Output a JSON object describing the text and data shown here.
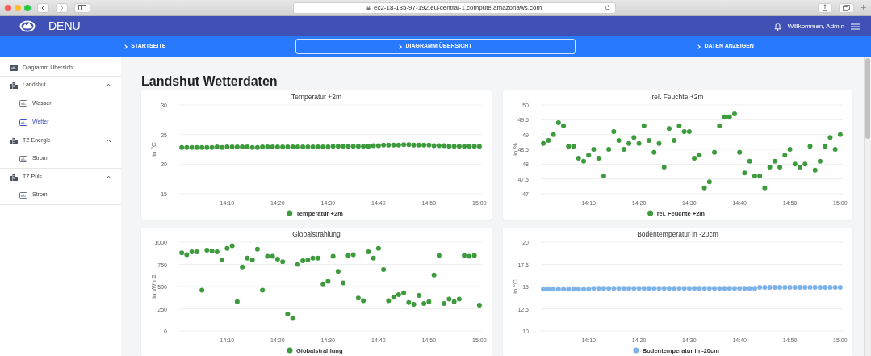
{
  "browser": {
    "url": "ec2-18-185-97-192.eu-central-1.compute.amazonaws.com"
  },
  "header": {
    "brand": "DENU",
    "greeting": "Willkommen, Admin"
  },
  "tabs": [
    {
      "label": "STARTSEITE",
      "selected": false
    },
    {
      "label": "DIAGRAMM ÜBERSICHT",
      "selected": true
    },
    {
      "label": "DATEN ANZEIGEN",
      "selected": false
    }
  ],
  "sidebar": {
    "items": [
      {
        "kind": "page",
        "label": "Diagramm Übersicht",
        "selected": false
      },
      {
        "kind": "group",
        "label": "Landshut",
        "expanded": true,
        "children": [
          {
            "label": "Wasser",
            "selected": false
          },
          {
            "label": "Wetter",
            "selected": true
          }
        ]
      },
      {
        "kind": "group",
        "label": "TZ Energie",
        "expanded": true,
        "children": [
          {
            "label": "Strom",
            "selected": false
          }
        ]
      },
      {
        "kind": "group",
        "label": "TZ Puls",
        "expanded": true,
        "children": [
          {
            "label": "Strom",
            "selected": false
          }
        ]
      }
    ]
  },
  "page_title": "Landshut Wetterdaten",
  "charts": [
    {
      "chart_data": {
        "type": "scatter",
        "title": "Temperatur +2m",
        "ylabel": "in °C",
        "grid": true,
        "ylim": [
          15,
          30
        ],
        "yticks": [
          15,
          20,
          25,
          30
        ],
        "categories": [
          null,
          null,
          null,
          null,
          null,
          null,
          null,
          null,
          null,
          "14:10",
          null,
          null,
          null,
          null,
          null,
          null,
          null,
          null,
          null,
          "14:20",
          null,
          null,
          null,
          null,
          null,
          null,
          null,
          null,
          null,
          "14:30",
          null,
          null,
          null,
          null,
          null,
          null,
          null,
          null,
          null,
          "14:40",
          null,
          null,
          null,
          null,
          null,
          null,
          null,
          null,
          null,
          "14:50",
          null,
          null,
          null,
          null,
          null,
          null,
          null,
          null,
          null,
          "15:00"
        ],
        "series": [
          {
            "name": "Temperatur +2m",
            "color": "#3d9b3d",
            "values": [
              22.8,
              22.8,
              22.8,
              22.8,
              22.8,
              22.8,
              22.8,
              22.9,
              22.8,
              22.9,
              22.9,
              22.9,
              22.9,
              22.9,
              22.8,
              22.8,
              22.9,
              22.9,
              22.9,
              22.9,
              22.9,
              22.9,
              22.9,
              22.9,
              22.9,
              22.9,
              22.9,
              22.9,
              22.9,
              22.9,
              23.0,
              23.0,
              23.0,
              23.0,
              23.0,
              23.0,
              23.0,
              23.0,
              23.1,
              23.1,
              23.2,
              23.2,
              23.2,
              23.2,
              23.3,
              23.3,
              23.2,
              23.2,
              23.2,
              23.2,
              23.1,
              23.1,
              23.1,
              23.0,
              23.0,
              23.0,
              23.0,
              23.0,
              23.0,
              23.0
            ]
          }
        ]
      }
    },
    {
      "chart_data": {
        "type": "scatter",
        "title": "rel. Feuchte +2m",
        "ylabel": "in %",
        "grid": true,
        "ylim": [
          47,
          50
        ],
        "yticks": [
          47,
          47.5,
          48,
          48.5,
          49,
          49.5,
          50
        ],
        "categories": [
          null,
          null,
          null,
          null,
          null,
          null,
          null,
          null,
          null,
          "14:10",
          null,
          null,
          null,
          null,
          null,
          null,
          null,
          null,
          null,
          "14:20",
          null,
          null,
          null,
          null,
          null,
          null,
          null,
          null,
          null,
          "14:30",
          null,
          null,
          null,
          null,
          null,
          null,
          null,
          null,
          null,
          "14:40",
          null,
          null,
          null,
          null,
          null,
          null,
          null,
          null,
          null,
          "14:50",
          null,
          null,
          null,
          null,
          null,
          null,
          null,
          null,
          null,
          "15:00"
        ],
        "series": [
          {
            "name": "rel. Feuchte +2m",
            "color": "#3d9b3d",
            "values": [
              48.7,
              48.8,
              49,
              49.4,
              49.3,
              48.6,
              48.6,
              48.2,
              48.1,
              48.3,
              48.5,
              48.2,
              47.6,
              48.5,
              49.1,
              48.8,
              48.5,
              48.7,
              48.9,
              48.7,
              49.3,
              48.8,
              48.4,
              48.7,
              47.9,
              49.2,
              48.8,
              49.3,
              49.1,
              49.1,
              48.2,
              48.3,
              47.2,
              47.4,
              48.4,
              49.3,
              49.6,
              49.6,
              49.7,
              48.4,
              47.7,
              48.1,
              47.6,
              47.6,
              47.2,
              47.9,
              48.1,
              47.9,
              48.3,
              48.5,
              48.0,
              47.9,
              48.0,
              48.6,
              47.8,
              48.1,
              48.6,
              48.9,
              48.5,
              49.0
            ]
          }
        ]
      }
    },
    {
      "chart_data": {
        "type": "scatter",
        "title": "Globalstrahlung",
        "ylabel": "in W/m2",
        "grid": true,
        "ylim": [
          0,
          1000
        ],
        "yticks": [
          0,
          250,
          500,
          750,
          1000
        ],
        "categories": [
          null,
          null,
          null,
          null,
          null,
          null,
          null,
          null,
          null,
          "14:10",
          null,
          null,
          null,
          null,
          null,
          null,
          null,
          null,
          null,
          "14:20",
          null,
          null,
          null,
          null,
          null,
          null,
          null,
          null,
          null,
          "14:30",
          null,
          null,
          null,
          null,
          null,
          null,
          null,
          null,
          null,
          "14:40",
          null,
          null,
          null,
          null,
          null,
          null,
          null,
          null,
          null,
          "14:50",
          null,
          null,
          null,
          null,
          null,
          null,
          null,
          null,
          null,
          "15:00"
        ],
        "series": [
          {
            "name": "Globalstrahlung",
            "color": "#3d9b3d",
            "values": [
              880,
              860,
              890,
              890,
              460,
              910,
              900,
              890,
              800,
              930,
              960,
              330,
              720,
              820,
              800,
              920,
              460,
              840,
              840,
              810,
              780,
              190,
              140,
              750,
              790,
              800,
              820,
              820,
              530,
              560,
              840,
              670,
              540,
              850,
              860,
              370,
              340,
              890,
              820,
              930,
              690,
              340,
              380,
              410,
              430,
              320,
              300,
              400,
              310,
              330,
              630,
              850,
              310,
              360,
              330,
              360,
              850,
              840,
              850,
              290
            ]
          }
        ]
      }
    },
    {
      "chart_data": {
        "type": "scatter",
        "title": "Bodentemperatur in -20cm",
        "ylabel": "in °C",
        "grid": true,
        "ylim": [
          10,
          20
        ],
        "yticks": [
          10,
          12.5,
          15,
          17.5,
          20
        ],
        "categories": [
          null,
          null,
          null,
          null,
          null,
          null,
          null,
          null,
          null,
          "14:10",
          null,
          null,
          null,
          null,
          null,
          null,
          null,
          null,
          null,
          "14:20",
          null,
          null,
          null,
          null,
          null,
          null,
          null,
          null,
          null,
          "14:30",
          null,
          null,
          null,
          null,
          null,
          null,
          null,
          null,
          null,
          "14:40",
          null,
          null,
          null,
          null,
          null,
          null,
          null,
          null,
          null,
          "14:50",
          null,
          null,
          null,
          null,
          null,
          null,
          null,
          null,
          null,
          "15:00"
        ],
        "series": [
          {
            "name": "Bodentemperatur in -20cm",
            "color": "#7eb3ea",
            "values": [
              14.7,
              14.7,
              14.7,
              14.7,
              14.7,
              14.7,
              14.7,
              14.7,
              14.7,
              14.7,
              14.8,
              14.8,
              14.8,
              14.8,
              14.8,
              14.8,
              14.8,
              14.8,
              14.8,
              14.8,
              14.8,
              14.8,
              14.8,
              14.8,
              14.8,
              14.8,
              14.8,
              14.8,
              14.8,
              14.8,
              14.8,
              14.8,
              14.8,
              14.8,
              14.8,
              14.8,
              14.8,
              14.8,
              14.8,
              14.8,
              14.8,
              14.8,
              14.8,
              14.9,
              14.9,
              14.9,
              14.9,
              14.9,
              14.9,
              14.9,
              14.9,
              14.9,
              14.9,
              14.9,
              14.9,
              14.9,
              14.9,
              14.9,
              14.9,
              14.9
            ]
          }
        ]
      }
    }
  ]
}
